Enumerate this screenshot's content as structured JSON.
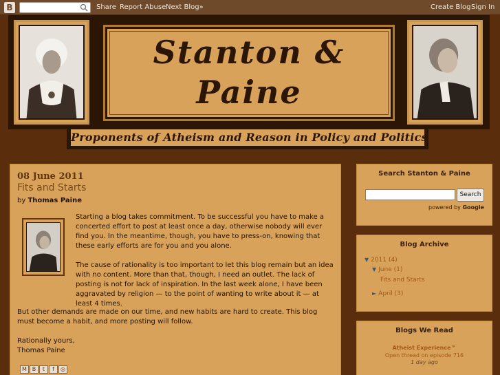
{
  "navbar": {
    "logo": "B",
    "share": "Share",
    "report_abuse": "Report Abuse",
    "next_blog": "Next Blog»",
    "create_blog": "Create Blog",
    "sign_in": "Sign In"
  },
  "header": {
    "title_line1": "Stanton  &",
    "title_line2": "Paine",
    "subtitle": "Proponents of Atheism and Reason in Policy and Politics"
  },
  "post": {
    "date": "08 June 2011",
    "title": "Fits and Starts",
    "byline_prefix": "by",
    "author": "Thomas Paine",
    "paragraphs": [
      "Starting a blog takes commitment. To be successful you have to make a concerted effort to post at least once a day, otherwise nobody will ever find you. In the meantime, though, you have to press-on, knowing that these early efforts are for you and you alone.",
      "The cause of rationality is too important to let this blog remain but an idea with no content. More than that, though, I need an outlet. The lack of posting is not for lack of inspiration. In the last week alone, I have been aggravated by religion — to the point of wanting to write about it — at least 4 times.",
      "But other demands are made on our time, and new habits are hard to create. This blog must become a habit, and more posting will follow.",
      "Rationally yours,",
      "Thomas Paine"
    ],
    "share_icons": [
      "email-icon",
      "blogger-icon",
      "twitter-icon",
      "facebook-icon",
      "buzz-icon"
    ]
  },
  "sidebar": {
    "search": {
      "title": "Search Stanton & Paine",
      "button": "Search",
      "powered_by": "powered by",
      "google": "Google"
    },
    "archive": {
      "title": "Blog Archive",
      "year": "2011",
      "year_count": "(4)",
      "month": "June",
      "month_count": "(1)",
      "post": "Fits and Starts",
      "month2": "April",
      "month2_count": "(3)"
    },
    "blogs": {
      "title": "Blogs We Read",
      "blog_name": "Atheist Experience™",
      "blog_post": "Open thread on episode 716",
      "blog_age": "1 day ago"
    }
  },
  "colors": {
    "background": "#5a2d0c",
    "panel": "#d9a25a",
    "dark": "#2b1505",
    "link": "#a05a16"
  }
}
